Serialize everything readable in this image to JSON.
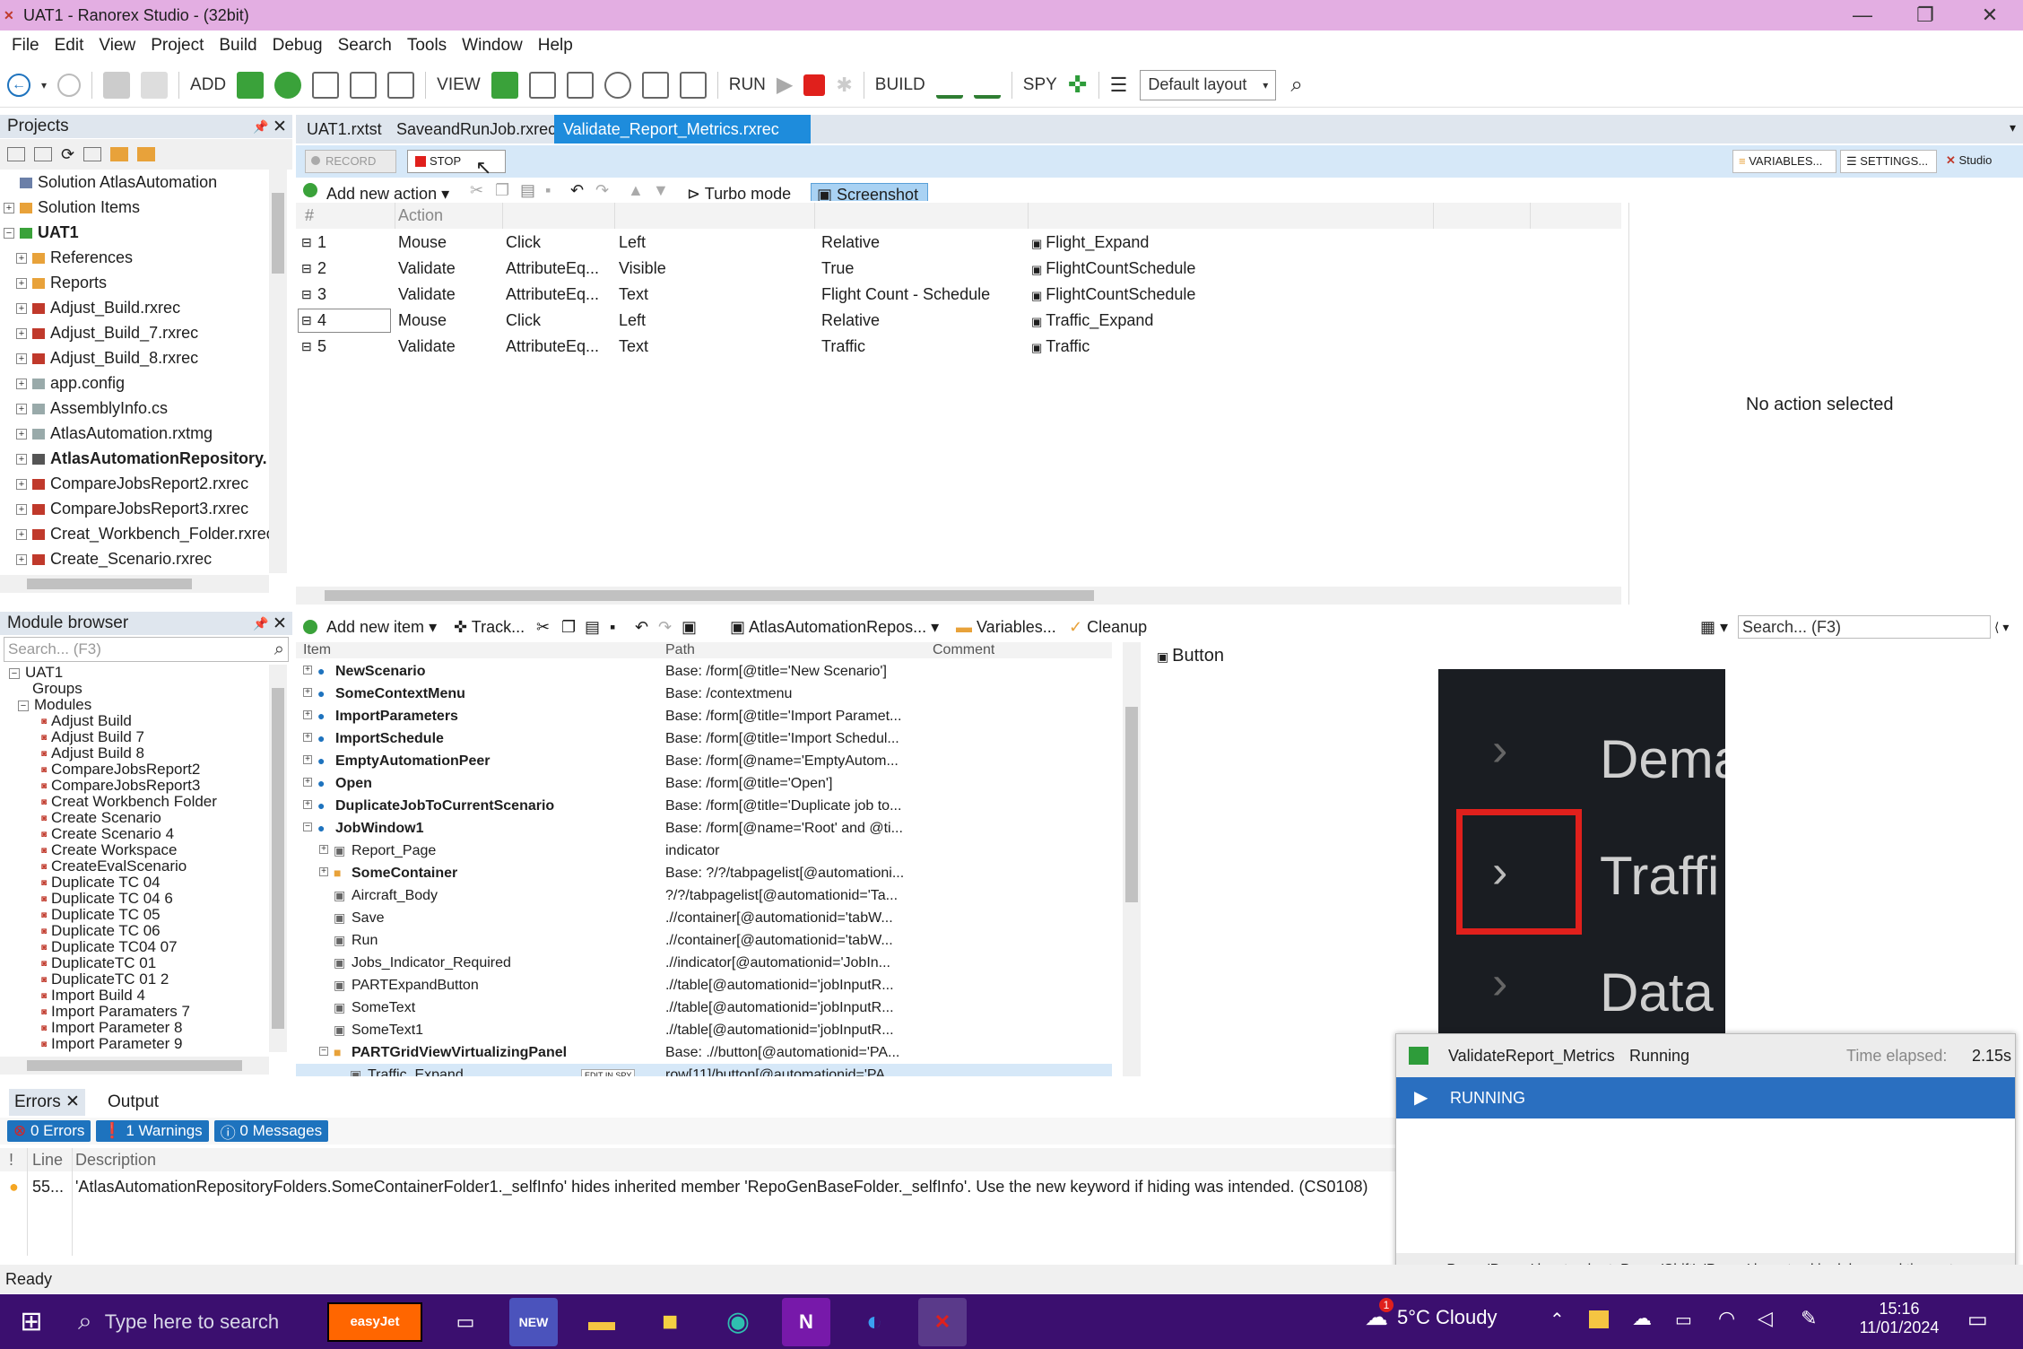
{
  "window": {
    "title": "UAT1 - Ranorex Studio - (32bit)"
  },
  "menu": [
    "File",
    "Edit",
    "View",
    "Project",
    "Build",
    "Debug",
    "Search",
    "Tools",
    "Window",
    "Help"
  ],
  "toolbar": {
    "add": "ADD",
    "view": "VIEW",
    "run": "RUN",
    "build": "BUILD",
    "spy": "SPY",
    "layout": "Default layout"
  },
  "projects": {
    "title": "Projects",
    "items": [
      {
        "label": "Solution AtlasAutomation",
        "level": 0,
        "icon": "solution-icon"
      },
      {
        "label": "Solution Items",
        "level": 0,
        "icon": "folder-icon"
      },
      {
        "label": "UAT1",
        "level": 0,
        "icon": "project-icon",
        "bold": true
      },
      {
        "label": "References",
        "level": 1,
        "icon": "folder-icon"
      },
      {
        "label": "Reports",
        "level": 1,
        "icon": "folder-icon"
      },
      {
        "label": "Adjust_Build.rxrec",
        "level": 1,
        "icon": "recording-icon"
      },
      {
        "label": "Adjust_Build_7.rxrec",
        "level": 1,
        "icon": "recording-icon"
      },
      {
        "label": "Adjust_Build_8.rxrec",
        "level": 1,
        "icon": "recording-icon"
      },
      {
        "label": "app.config",
        "level": 1,
        "icon": "file-icon"
      },
      {
        "label": "AssemblyInfo.cs",
        "level": 1,
        "icon": "file-icon"
      },
      {
        "label": "AtlasAutomation.rxtmg",
        "level": 1,
        "icon": "file-icon"
      },
      {
        "label": "AtlasAutomationRepository.",
        "level": 1,
        "icon": "repository-icon",
        "bold": true
      },
      {
        "label": "CompareJobsReport2.rxrec",
        "level": 1,
        "icon": "recording-icon"
      },
      {
        "label": "CompareJobsReport3.rxrec",
        "level": 1,
        "icon": "recording-icon"
      },
      {
        "label": "Creat_Workbench_Folder.rxrec",
        "level": 1,
        "icon": "recording-icon"
      },
      {
        "label": "Create_Scenario.rxrec",
        "level": 1,
        "icon": "recording-icon"
      }
    ]
  },
  "module_browser": {
    "title": "Module browser",
    "search_placeholder": "Search... (F3)",
    "root": "UAT1",
    "groups": "Groups",
    "modules_label": "Modules",
    "modules": [
      "Adjust Build",
      "Adjust Build 7",
      "Adjust Build 8",
      "CompareJobsReport2",
      "CompareJobsReport3",
      "Creat Workbench Folder",
      "Create Scenario",
      "Create Scenario 4",
      "Create Workspace",
      "CreateEvalScenario",
      "Duplicate TC 04",
      "Duplicate TC 04 6",
      "Duplicate TC 05",
      "Duplicate TC 06",
      "Duplicate TC04 07",
      "DuplicateTC 01",
      "DuplicateTC 01 2",
      "Import Build 4",
      "Import Paramaters 7",
      "Import Parameter 8",
      "Import Parameter 9"
    ]
  },
  "tabs": [
    "UAT1.rxtst",
    "SaveandRunJob.rxrec",
    "Validate_Report_Metrics.rxrec"
  ],
  "recorder": {
    "record": "RECORD",
    "stop": "STOP",
    "variables": "VARIABLES...",
    "settings": "SETTINGS...",
    "studio": "Studio",
    "add_action": "Add new action",
    "turbo": "Turbo mode",
    "screenshot": "Screenshot"
  },
  "actions": {
    "headers": [
      "#",
      "Action",
      "",
      "",
      "",
      ""
    ],
    "rows": [
      [
        "1",
        "Mouse",
        "Click",
        "Left",
        "Relative",
        "Flight_Expand"
      ],
      [
        "2",
        "Validate",
        "AttributeEq...",
        "Visible",
        "True",
        "FlightCountSchedule"
      ],
      [
        "3",
        "Validate",
        "AttributeEq...",
        "Text",
        "Flight Count - Schedule",
        "FlightCountSchedule"
      ],
      [
        "4",
        "Mouse",
        "Click",
        "Left",
        "Relative",
        "Traffic_Expand"
      ],
      [
        "5",
        "Validate",
        "AttributeEq...",
        "Text",
        "Traffic",
        "Traffic"
      ]
    ],
    "no_selection": "No action selected"
  },
  "repository": {
    "add_item": "Add new item",
    "track": "Track...",
    "repo_name": "AtlasAutomationRepos...",
    "variables": "Variables...",
    "cleanup": "Cleanup",
    "search_placeholder": "Search... (F3)",
    "headers": [
      "Item",
      "Path",
      "Comment"
    ],
    "edit_in_spy": "EDIT IN SPY",
    "rows": [
      {
        "name": "NewScenario",
        "path": "Base: /form[@title='New Scenario']",
        "level": 0,
        "bold": true
      },
      {
        "name": "SomeContextMenu",
        "path": "Base: /contextmenu",
        "level": 0,
        "bold": true
      },
      {
        "name": "ImportParameters",
        "path": "Base: /form[@title='Import Paramet...",
        "level": 0,
        "bold": true
      },
      {
        "name": "ImportSchedule",
        "path": "Base: /form[@title='Import Schedul...",
        "level": 0,
        "bold": true
      },
      {
        "name": "EmptyAutomationPeer",
        "path": "Base: /form[@name='EmptyAutom...",
        "level": 0,
        "bold": true
      },
      {
        "name": "Open",
        "path": "Base: /form[@title='Open']",
        "level": 0,
        "bold": true
      },
      {
        "name": "DuplicateJobToCurrentScenario",
        "path": "Base: /form[@title='Duplicate job to...",
        "level": 0,
        "bold": true
      },
      {
        "name": "JobWindow1",
        "path": "Base: /form[@name='Root' and @ti...",
        "level": 0,
        "bold": true
      },
      {
        "name": "Report_Page",
        "path": "indicator",
        "level": 1,
        "bold": false
      },
      {
        "name": "SomeContainer",
        "path": "Base: ?/?/tabpagelist[@automationi...",
        "level": 1,
        "bold": true
      },
      {
        "name": "Aircraft_Body",
        "path": "?/?/tabpagelist[@automationid='Ta...",
        "level": 1,
        "bold": false
      },
      {
        "name": "Save",
        "path": ".//container[@automationid='tabW...",
        "level": 1,
        "bold": false
      },
      {
        "name": "Run",
        "path": ".//container[@automationid='tabW...",
        "level": 1,
        "bold": false
      },
      {
        "name": "Jobs_Indicator_Required",
        "path": ".//indicator[@automationid='JobIn...",
        "level": 1,
        "bold": false
      },
      {
        "name": "PARTExpandButton",
        "path": ".//table[@automationid='jobInputR...",
        "level": 1,
        "bold": false
      },
      {
        "name": "SomeText",
        "path": ".//table[@automationid='jobInputR...",
        "level": 1,
        "bold": false
      },
      {
        "name": "SomeText1",
        "path": ".//table[@automationid='jobInputR...",
        "level": 1,
        "bold": false
      },
      {
        "name": "PARTGridViewVirtualizingPanel",
        "path": "Base: .//button[@automationid='PA...",
        "level": 1,
        "bold": true
      },
      {
        "name": "Traffic_Expand",
        "path": "row[11]/button[@automationid='PA...",
        "level": 2,
        "bold": false
      }
    ]
  },
  "preview": {
    "title": "Button",
    "labels": [
      "Dema",
      "Traffi",
      "Data"
    ]
  },
  "run_panel": {
    "module": "ValidateReport_Metrics",
    "status": "Running",
    "elapsed_label": "Time elapsed:",
    "elapsed": "2.15s",
    "banner": "RUNNING",
    "hint": "Press 'Pause' key to abort. Press 'Shift'+'Pause' keys to skip delays and timeouts."
  },
  "errors": {
    "tab_errors": "Errors",
    "tab_output": "Output",
    "errors_badge": "0 Errors",
    "warnings_badge": "1 Warnings",
    "messages_badge": "0 Messages",
    "headers": [
      "!",
      "Line",
      "Description"
    ],
    "rows": [
      {
        "line": "55...",
        "desc": "'AtlasAutomationRepositoryFolders.SomeContainerFolder1._selfInfo' hides inherited member 'RepoGenBaseFolder._selfInfo'. Use the new keyword if hiding was intended. (CS0108)"
      }
    ]
  },
  "status": "Ready",
  "taskbar": {
    "search_placeholder": "Type here to search",
    "weather": "5°C  Cloudy",
    "time": "15:16",
    "date": "11/01/2024",
    "notification_count": "1",
    "easyjet": "easyJet",
    "new_badge": "NEW"
  },
  "colors": {
    "title": "#e3aee2",
    "accent": "#1e73be",
    "taskbar": "#3b0f6f",
    "running": "#2a6fc0"
  }
}
